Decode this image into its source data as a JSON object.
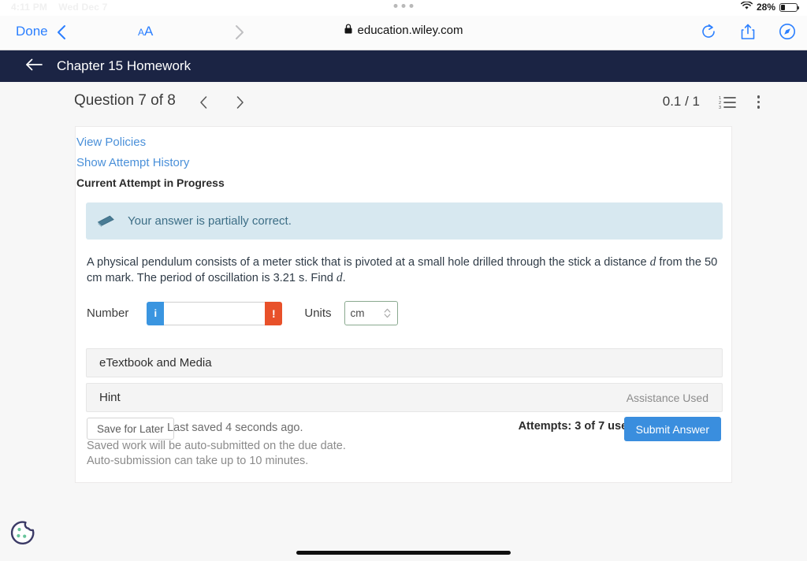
{
  "status_bar": {
    "time": "4:11 PM",
    "date": "Wed Dec 7",
    "battery_percent": "28%",
    "wifi_icon": "wifi-icon",
    "battery_icon": "battery-icon"
  },
  "browser": {
    "done_label": "Done",
    "back_icon": "chevron-left-icon",
    "forward_icon": "chevron-right-icon",
    "text_size_small": "A",
    "text_size_large": "A",
    "lock_icon": "lock-icon",
    "url": "education.wiley.com",
    "reload_icon": "reload-icon",
    "share_icon": "share-icon",
    "tabs_icon": "compass-icon"
  },
  "app_header": {
    "back_icon": "arrow-left-icon",
    "title": "Chapter 15 Homework"
  },
  "question_bar": {
    "title": "Question 7 of 8",
    "prev_icon": "chevron-left-icon",
    "next_icon": "chevron-right-icon",
    "score": "0.1 / 1",
    "list_icon": "numbered-list-icon",
    "menu_icon": "kebab-menu-icon"
  },
  "content": {
    "view_policies": "View Policies",
    "show_attempt_history": "Show Attempt History",
    "attempt_status": "Current Attempt in Progress",
    "alert": {
      "icon": "eraser-icon",
      "message": "Your answer is partially correct."
    },
    "question": {
      "part1": "A physical pendulum consists of a meter stick that is pivoted at a small hole drilled through the stick a distance ",
      "var1": "d",
      "part2": " from the 50 cm mark. The period of oscillation is 3.21 s. Find ",
      "var2": "d",
      "part3": "."
    },
    "answer": {
      "number_label": "Number",
      "info_badge": "i",
      "error_badge": "!",
      "number_value": "",
      "number_placeholder": "",
      "units_label": "Units",
      "units_value": "cm",
      "units_stepper_icon": "stepper-icon"
    },
    "panels": [
      {
        "title": "eTextbook and Media",
        "right": ""
      },
      {
        "title": "Hint",
        "right": "Assistance Used"
      }
    ],
    "footer": {
      "save_label": "Save for Later",
      "last_saved": "Last saved 4 seconds ago.",
      "attempts": "Attempts: 3 of 7 used",
      "submit_label": "Submit Answer",
      "auto_note": "Saved work will be auto-submitted on the due date. Auto-submission can take up to 10 minutes."
    }
  },
  "cookie_widget": {
    "icon": "cookie-icon"
  },
  "colors": {
    "header_navy": "#1b2444",
    "link_blue": "#4a90d9",
    "submit_blue": "#3a8ede",
    "alert_bg": "#d7e8f0",
    "badge_info": "#3a95e0",
    "badge_error": "#e8512a"
  }
}
